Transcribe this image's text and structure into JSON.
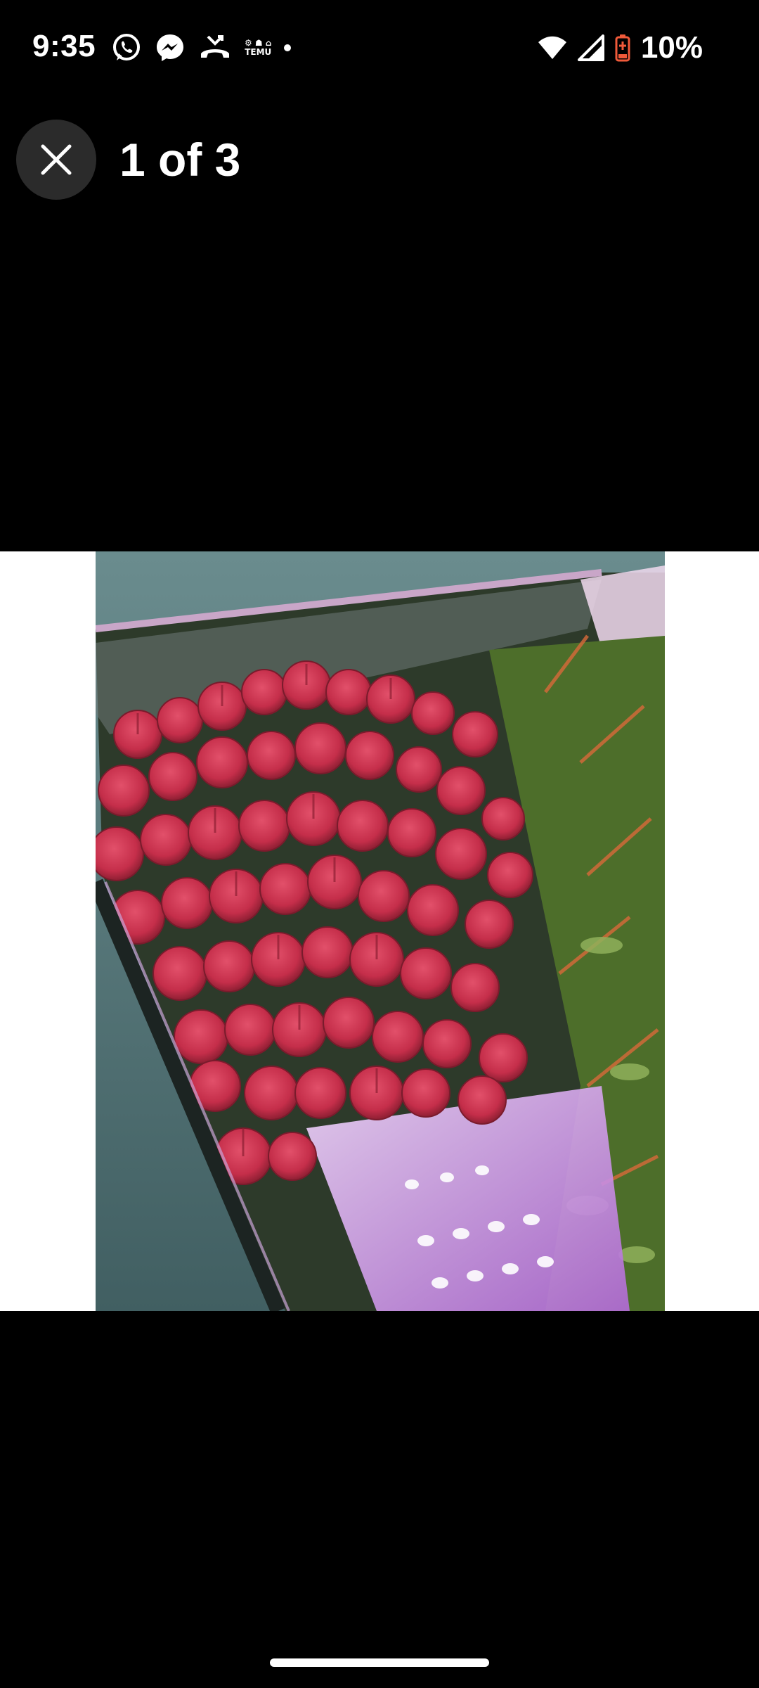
{
  "status_bar": {
    "time": "9:35",
    "notification_icons": [
      "whatsapp-icon",
      "messenger-icon",
      "missed-call-icon",
      "temu-icon",
      "more-notifications-dot"
    ],
    "temu_label": "TEMU",
    "system_icons": [
      "wifi-icon",
      "cellular-signal-icon",
      "battery-low-icon"
    ],
    "battery_percent": "10%",
    "battery_color": "#f05a3a"
  },
  "viewer": {
    "close_icon": "close-icon",
    "counter_text": "1 of 3",
    "image_description_icon": "photo"
  },
  "colors": {
    "background": "#000000",
    "close_button_bg": "#2b2b2b",
    "image_letterbox": "#ffffff"
  }
}
